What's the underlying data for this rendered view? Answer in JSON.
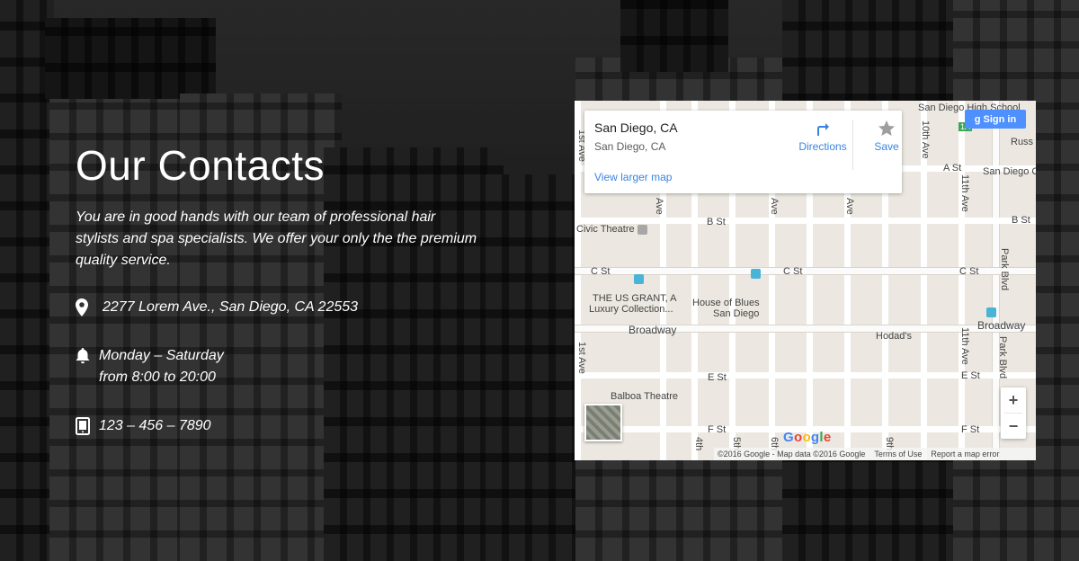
{
  "section": {
    "title": "Our Contacts",
    "intro": "You are in good hands with our team of professional hair stylists and spa specialists. We offer your only the the premium quality service."
  },
  "contact": {
    "address": "2277 Lorem Ave., San Diego, CA 22553",
    "hours_line1": "Monday – Saturday",
    "hours_line2": "from 8:00 to 20:00",
    "phone": "123 – 456 – 7890"
  },
  "map": {
    "place_name": "San Diego, CA",
    "place_address": "San Diego, CA",
    "larger_map": "View larger map",
    "directions": "Directions",
    "save": "Save",
    "sign_in": "Sign in",
    "zoom_in": "+",
    "zoom_out": "−",
    "attribution": "©2016 Google - Map data ©2016 Google",
    "terms": "Terms of Use",
    "report": "Report a map error",
    "labels": {
      "high_school": "San Diego High School",
      "russ": "Russ",
      "a_st": "A St",
      "san_diego_c": "San Diego C",
      "b_st_left": "B St",
      "b_st_right": "B St",
      "c_st_left": "C St",
      "c_st_mid": "C St",
      "c_st_right": "C St",
      "civic_theatre": "Civic Theatre",
      "us_grant_1": "THE US GRANT, A",
      "us_grant_2": "Luxury Collection...",
      "house_blues_1": "House of Blues",
      "house_blues_2": "San Diego",
      "broadway_left": "Broadway",
      "broadway_right": "Broadway",
      "hodads": "Hodad's",
      "e_st_left": "E St",
      "e_st_right": "E St",
      "balboa_theatre": "Balboa Theatre",
      "f_st_left": "F St",
      "f_st_right": "F St",
      "tenth_ave": "10th Ave",
      "eleventh_ave": "11th Ave",
      "eleventh_ave_2": "11th Ave",
      "park_blvd": "Park Blvd",
      "park_blvd_2": "Park Blvd",
      "first_ave": "1st Ave",
      "first_ave_2": "1st Ave",
      "fourth": "4th",
      "fifth": "5th",
      "sixth": "6th",
      "ninth": "9th",
      "ave_a": "Ave",
      "ave_b": "Ave",
      "ave_c": "Ave",
      "route_badge": "1A"
    },
    "google_logo": "Google",
    "colors": {
      "link": "#3a84df",
      "signin": "#4d90fe"
    }
  }
}
